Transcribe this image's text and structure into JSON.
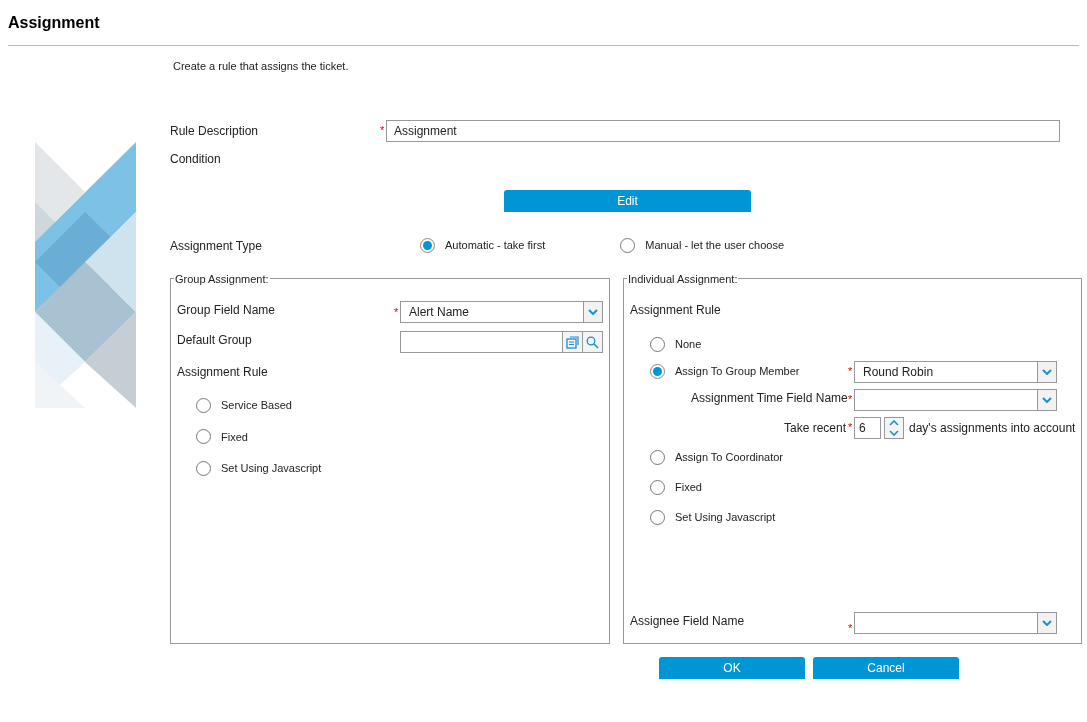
{
  "page": {
    "title": "Assignment",
    "description": "Create a rule that assigns the ticket."
  },
  "rule_description": {
    "label": "Rule Description",
    "value": "Assignment",
    "required_mark": "*"
  },
  "condition": {
    "label": "Condition",
    "button": "Edit"
  },
  "assignment_type": {
    "label": "Assignment Type",
    "options": [
      {
        "label": "Automatic - take first",
        "selected": true
      },
      {
        "label": "Manual - let the user choose",
        "selected": false
      }
    ]
  },
  "group_assignment": {
    "legend": "Group Assignment:",
    "fields": [
      {
        "kind": "dropdown",
        "label": "Group Field Name",
        "value": "Alert Name",
        "required_mark": "*"
      },
      {
        "kind": "lookup",
        "label": "Default Group"
      }
    ],
    "rule_label": "Assignment Rule",
    "rules": [
      {
        "label": "Service Based",
        "selected": false
      },
      {
        "label": "Fixed",
        "selected": false
      },
      {
        "label": "Set Using Javascript",
        "selected": false
      }
    ]
  },
  "individual_assignment": {
    "legend": "Individual Assignment:",
    "rule_label": "Assignment Rule",
    "rules": [
      {
        "label": "None",
        "selected": false
      },
      {
        "label": "Assign To Group Member",
        "selected": true,
        "dropdown": {
          "value": "Round Robin",
          "required_mark": "*"
        },
        "time_field": {
          "label": "Assignment Time Field Name",
          "required_mark": "*"
        },
        "recent": {
          "prefix": "Take recent",
          "value": "6",
          "suffix": "day's assignments into account",
          "required_mark": "*"
        }
      },
      {
        "label": "Assign To Coordinator",
        "selected": false
      },
      {
        "label": "Fixed",
        "selected": false
      },
      {
        "label": "Set Using Javascript",
        "selected": false
      }
    ],
    "assignee_field": {
      "label": "Assignee Field Name",
      "required_mark": "*"
    }
  },
  "buttons": [
    "OK",
    "Cancel"
  ]
}
